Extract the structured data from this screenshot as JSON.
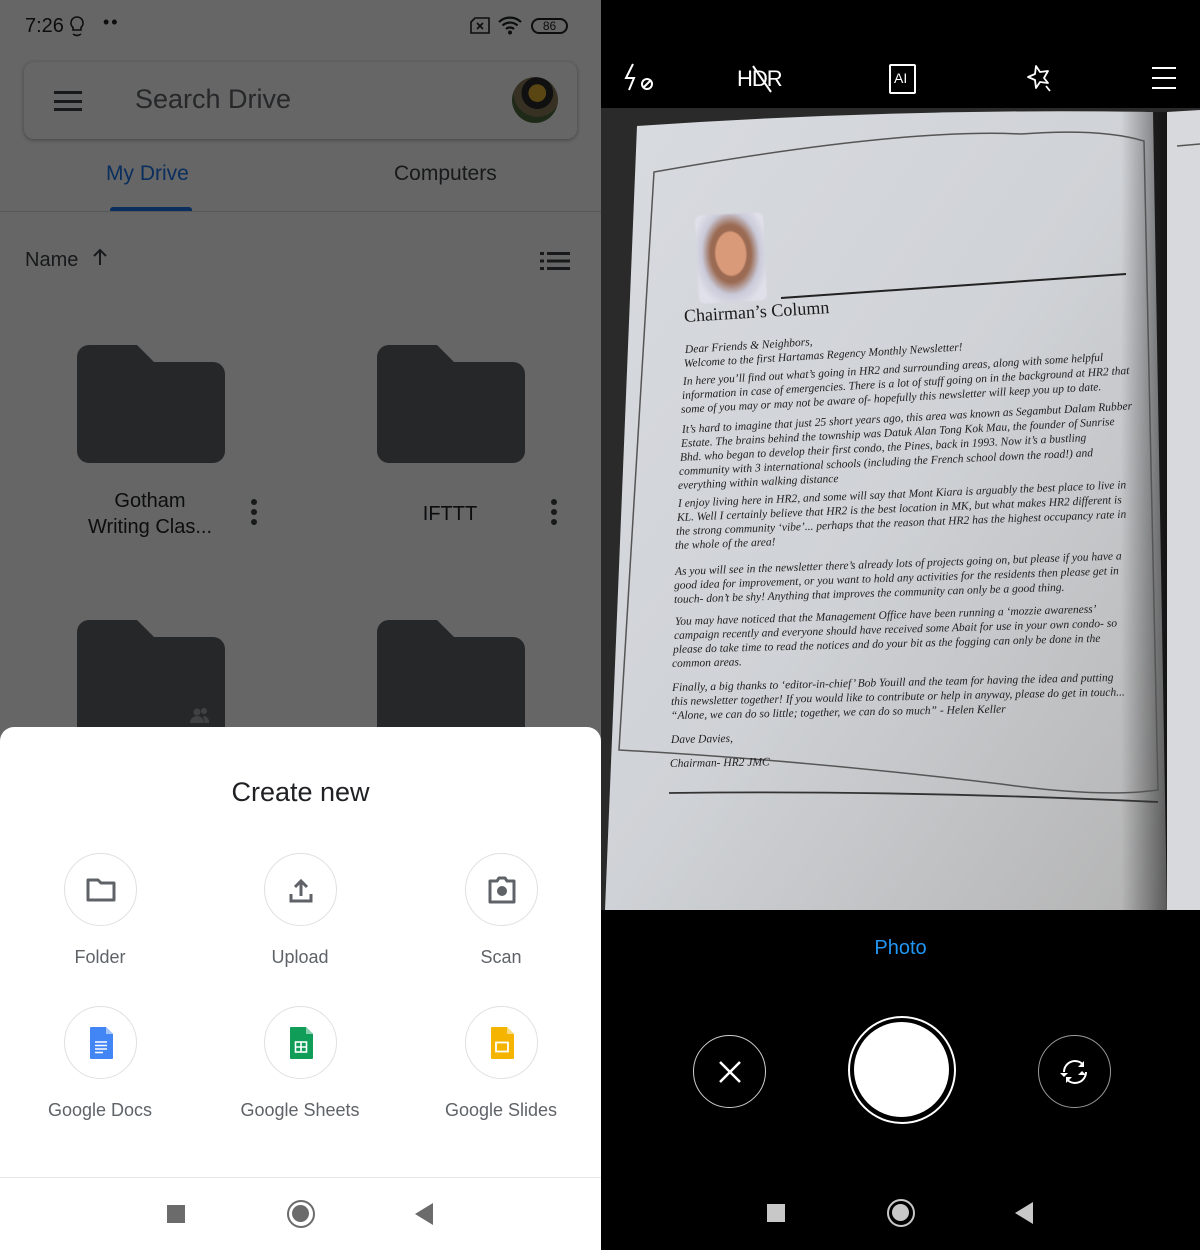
{
  "drive": {
    "status_bar": {
      "time": "7:26",
      "dots": "••",
      "battery": "86"
    },
    "search": {
      "placeholder": "Search Drive"
    },
    "tabs": [
      {
        "label": "My Drive",
        "active": true
      },
      {
        "label": "Computers",
        "active": false
      }
    ],
    "sort": {
      "label": "Name",
      "direction_icon": "arrow-up-icon"
    },
    "folders": [
      {
        "name_line1": "Gotham",
        "name_line2": "Writing Clas...",
        "shared": false
      },
      {
        "name_line1": "IFTTT",
        "name_line2": "",
        "shared": false
      },
      {
        "name_line1": "",
        "name_line2": "",
        "shared": true
      },
      {
        "name_line1": "",
        "name_line2": "",
        "shared": false
      }
    ],
    "create_sheet": {
      "title": "Create new",
      "items": [
        {
          "label": "Folder",
          "icon": "folder-icon"
        },
        {
          "label": "Upload",
          "icon": "upload-icon"
        },
        {
          "label": "Scan",
          "icon": "camera-icon"
        },
        {
          "label": "Google Docs",
          "icon": "google-docs-icon"
        },
        {
          "label": "Google Sheets",
          "icon": "google-sheets-icon"
        },
        {
          "label": "Google Slides",
          "icon": "google-slides-icon"
        }
      ]
    },
    "colors": {
      "accent": "#1a73e8",
      "docs": "#4285f4",
      "sheets": "#0f9d58",
      "slides": "#f4b400"
    }
  },
  "camera": {
    "toolbar": {
      "flash": "flash-off-icon",
      "hdr": "HDR",
      "ai": "AI",
      "beauty": "magic-star-icon",
      "menu": "menu-icon"
    },
    "mode": "Photo",
    "mode_color": "#2196f3",
    "document": {
      "heading": "Chairman’s Column",
      "lines": [
        "Dear Friends & Neighbors,",
        "Welcome to the first Hartamas Regency Monthly Newsletter!",
        "In here you’ll find out what’s going in HR2 and surrounding areas, along with some helpful",
        "information in case of emergencies. There is a lot of stuff going on in the background at HR2 that",
        "some of you may or may not be aware of- hopefully this newsletter will keep you up to date.",
        "It’s hard to imagine that just 25 short years ago, this area was known as Segambut Dalam Rubber",
        "Estate. The brains behind the township was Datuk Alan Tong Kok Mau, the founder of Sunrise",
        "Bhd. who began to develop their first condo, the Pines, back in 1993. Now it’s a bustling",
        "community with 3 international schools (including the French school down the road!) and",
        "everything within walking distance",
        "I enjoy living here in HR2, and some will say that Mont Kiara is arguably the best place to live in",
        "KL. Well I certainly believe that HR2 is the best location in MK, but what makes HR2 different is",
        "the strong community ‘vibe’... perhaps that the reason that HR2 has the highest occupancy rate in",
        "the whole of the area!",
        "As you will see in the newsletter there’s already lots of projects going on, but please if you have a",
        "good idea for improvement, or you want to hold any activities for the residents then please get in",
        "touch- don’t be shy! Anything that improves the community can only be a good thing.",
        "You may have noticed that the Management Office have been running a ‘mozzie awareness’",
        "campaign recently and everyone should have received some Abait for use in your own condo- so",
        "please do take time to read the notices and do your bit as the fogging can only be done in the",
        "common areas.",
        "Finally, a big thanks to ‘editor-in-chief’ Bob Youill and the team for having the idea and putting",
        "this newsletter together! If you would like to contribute or help in anyway, please do get in touch...",
        "“Alone, we can do so little; together, we can do so much” - Helen Keller",
        "Dave Davies,",
        "Chairman- HR2 JMC"
      ]
    }
  }
}
